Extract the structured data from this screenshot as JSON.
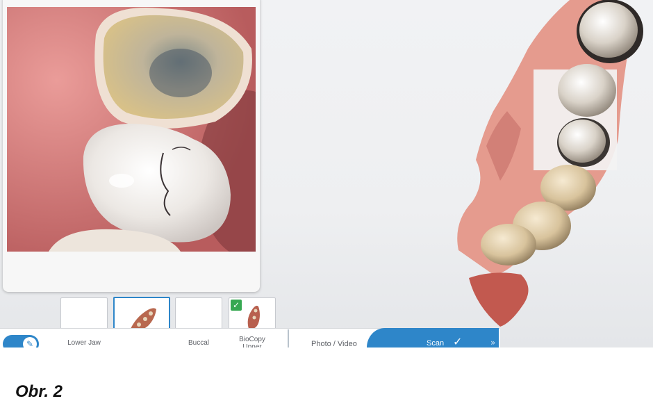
{
  "photo_panel": {
    "alt": "intraoral-photo"
  },
  "thumbnails": [
    {
      "label": "Lower Jaw",
      "has_check": false,
      "has_model": false
    },
    {
      "label": "",
      "has_check": false,
      "has_model": true
    },
    {
      "label": "Buccal",
      "has_check": false,
      "has_model": false
    },
    {
      "label": "BioCopy\nUpper",
      "has_check": true,
      "has_model": true
    }
  ],
  "toolbar": {
    "toggle_icon": "pen-icon",
    "tabs": {
      "photo_video": "Photo / Video",
      "scan": "Scan"
    },
    "scan_check": "✓",
    "scan_chevron": "»"
  },
  "check_glyph": "✓",
  "caption": "Obr. 2",
  "colors": {
    "accent": "#2e86c9",
    "check": "#36a852"
  }
}
